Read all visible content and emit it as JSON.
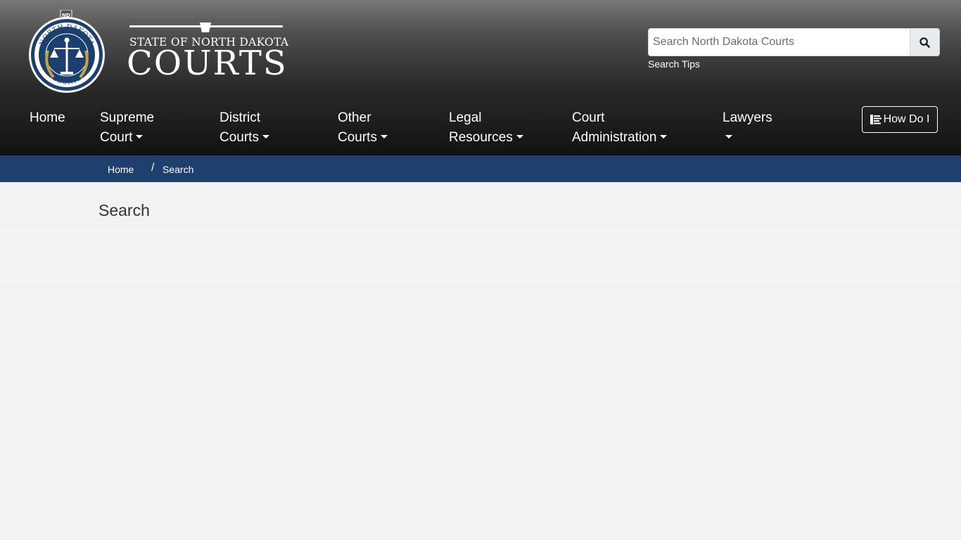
{
  "header": {
    "logo": {
      "seal_top_text": "NORTH DAKOTA",
      "seal_bottom_text": "COURTS",
      "seal_badge": "ND",
      "state_line": "STATE OF NORTH DAKOTA",
      "courts_word": "COURTS"
    },
    "search": {
      "placeholder": "Search North Dakota Courts",
      "value": "",
      "button_icon": "search-icon",
      "tips_label": "Search Tips"
    }
  },
  "nav": {
    "items": [
      {
        "line1": "Home",
        "line2": ""
      },
      {
        "line1": "Supreme",
        "line2": "Court"
      },
      {
        "line1": "District",
        "line2": "Courts"
      },
      {
        "line1": "Other",
        "line2": "Courts"
      },
      {
        "line1": "Legal",
        "line2": "Resources"
      },
      {
        "line1": "Court",
        "line2": "Administration"
      },
      {
        "line1": "Lawyers",
        "line2": ""
      }
    ],
    "how_do_i": {
      "label": "How Do I",
      "icon": "align-left-icon"
    }
  },
  "breadcrumb": {
    "home": "Home",
    "separator": "/",
    "current": "Search"
  },
  "main": {
    "title": "Search"
  },
  "colors": {
    "breadcrumb_bar": "#1f3f6e",
    "seal_blue": "#1b3f6f",
    "seal_gold": "#c9a23a",
    "page_bg": "#f2f2f2"
  }
}
